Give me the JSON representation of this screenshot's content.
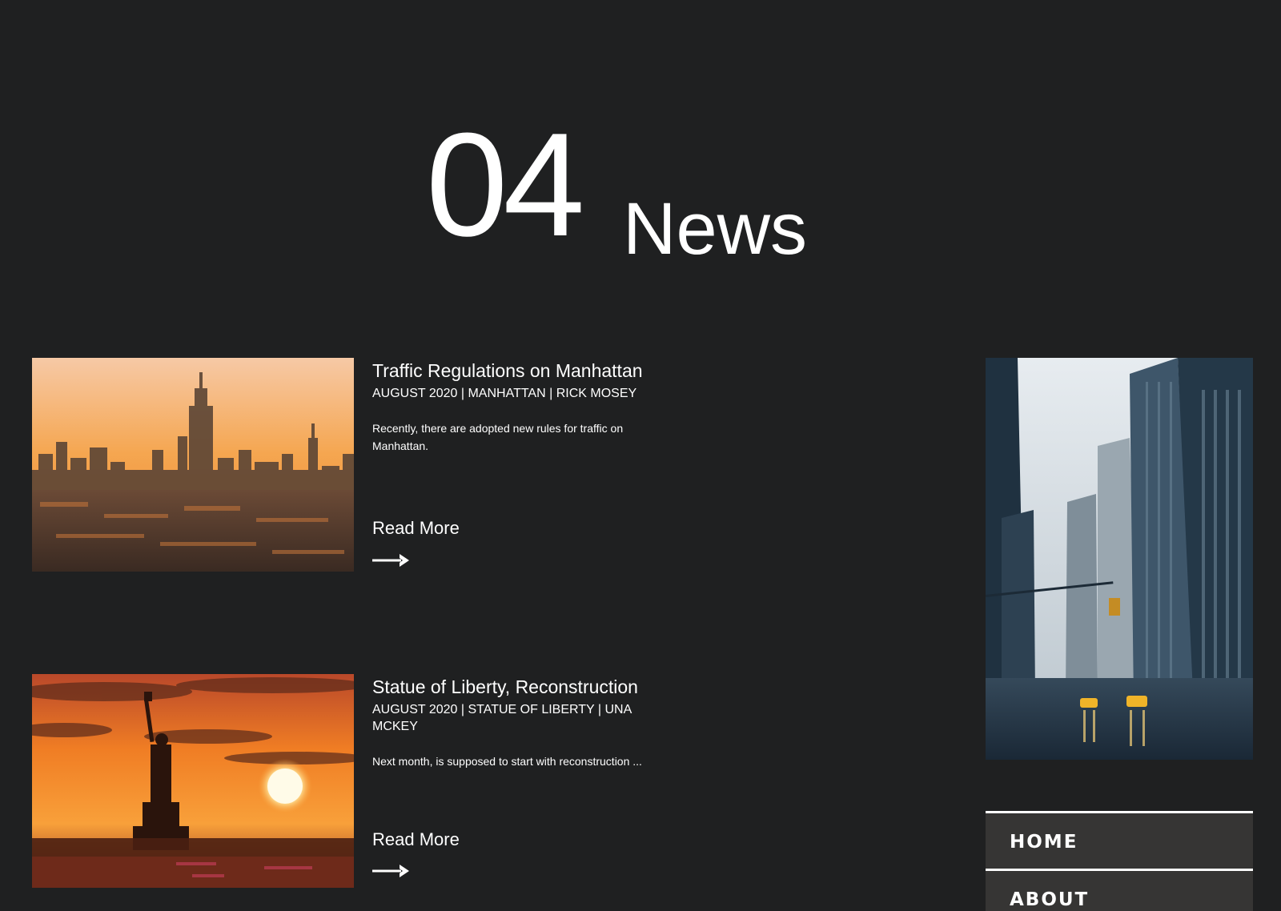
{
  "section": {
    "number": "04",
    "title": "News"
  },
  "articles": [
    {
      "title": "Traffic Regulations on Manhattan",
      "meta": "AUGUST 2020 | MANHATTAN | RICK MOSEY",
      "excerpt": "Recently, there are adopted new rules for traffic on Manhattan.",
      "read_more": "Read More",
      "image": "manhattan-skyline-sunset"
    },
    {
      "title": "Statue of Liberty, Reconstruction",
      "meta": "AUGUST 2020 | STATUE OF LIBERTY | UNA MCKEY",
      "excerpt": "Next month, is supposed to start with reconstruction ...",
      "read_more": "Read More",
      "image": "statue-of-liberty-sunset"
    }
  ],
  "side_image": "city-street-skyscrapers",
  "nav": {
    "items": [
      "HOME",
      "ABOUT"
    ]
  },
  "colors": {
    "background": "#1f2021",
    "text": "#ffffff",
    "nav_background": "#363534"
  }
}
